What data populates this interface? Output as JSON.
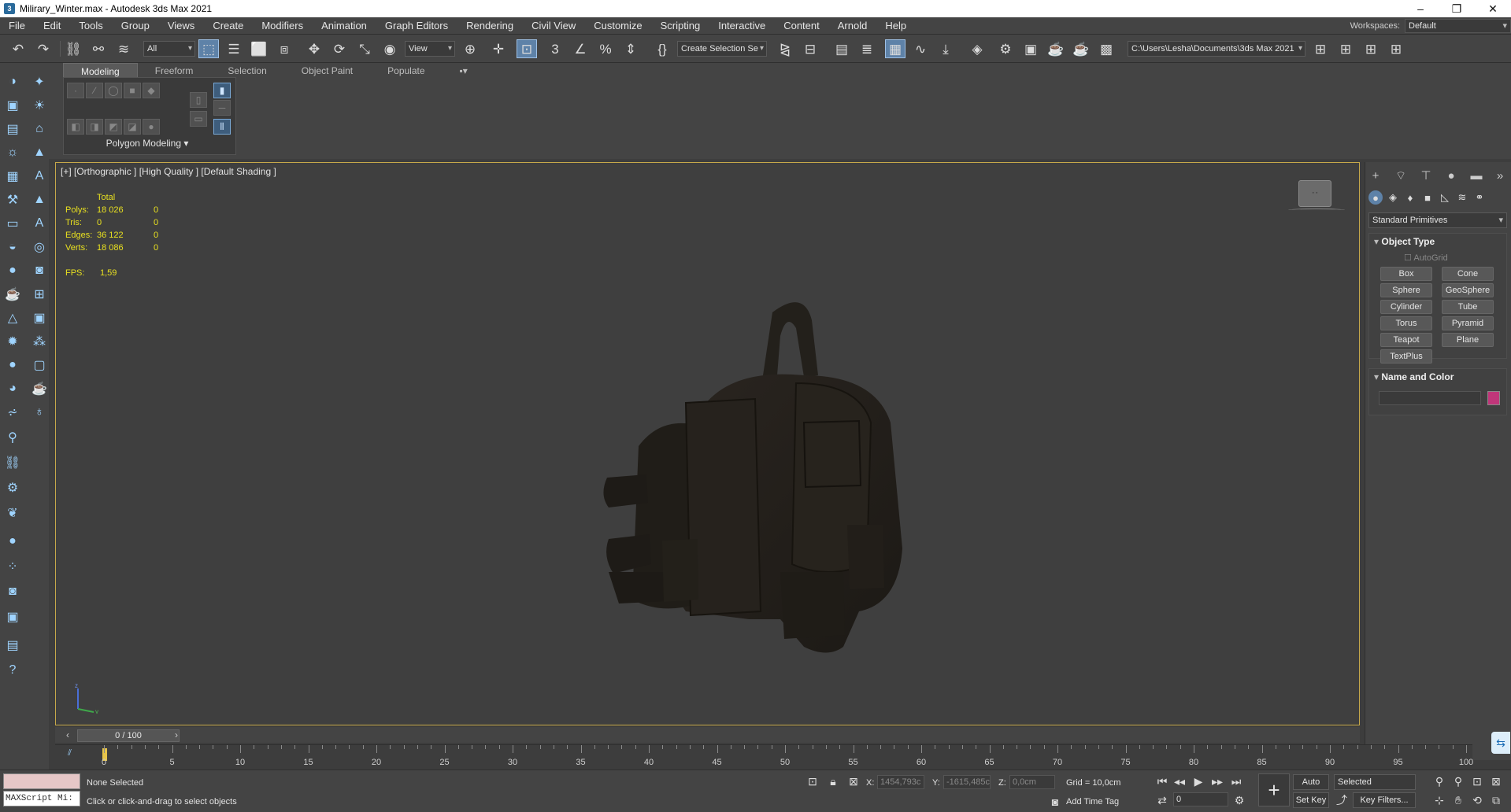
{
  "window": {
    "title": "Milirary_Winter.max - Autodesk 3ds Max 2021"
  },
  "menu": [
    "File",
    "Edit",
    "Tools",
    "Group",
    "Views",
    "Create",
    "Modifiers",
    "Animation",
    "Graph Editors",
    "Rendering",
    "Civil View",
    "Customize",
    "Scripting",
    "Interactive",
    "Content",
    "Arnold",
    "Help"
  ],
  "workspace": {
    "label": "Workspaces:",
    "value": "Default"
  },
  "toolbar": {
    "filter": "All",
    "ref_coord": "View",
    "selection_set": "Create Selection Se",
    "project_path": "C:\\Users\\Lesha\\Documents\\3ds Max 2021"
  },
  "ribbon": {
    "tabs": [
      "Modeling",
      "Freeform",
      "Selection",
      "Object Paint",
      "Populate"
    ],
    "panel_title": "Polygon Modeling"
  },
  "viewport": {
    "label": "[+] [Orthographic ] [High Quality ] [Default Shading ]",
    "stats": {
      "header": "Total",
      "rows": [
        {
          "k": "Polys:",
          "v": "18 026",
          "s": "0"
        },
        {
          "k": "Tris:",
          "v": "0",
          "s": "0"
        },
        {
          "k": "Edges:",
          "v": "36 122",
          "s": "0"
        },
        {
          "k": "Verts:",
          "v": "18 086",
          "s": "0"
        }
      ],
      "fps_label": "FPS:",
      "fps": "1,59"
    },
    "gizmo": {
      "x": "x",
      "y": "y",
      "z": "z"
    }
  },
  "command_panel": {
    "dropdown": "Standard Primitives",
    "object_type": {
      "title": "Object Type",
      "autogrid": "AutoGrid",
      "buttons": [
        "Box",
        "Cone",
        "Sphere",
        "GeoSphere",
        "Cylinder",
        "Tube",
        "Torus",
        "Pyramid",
        "Teapot",
        "Plane",
        "TextPlus"
      ]
    },
    "name_color": {
      "title": "Name and Color",
      "color": "#c0367a"
    }
  },
  "timeline": {
    "frame": "0 / 100",
    "ticks": [
      "0",
      "5",
      "10",
      "15",
      "20",
      "25",
      "30",
      "35",
      "40",
      "45",
      "50",
      "55",
      "60",
      "65",
      "70",
      "75",
      "80",
      "85",
      "90",
      "95",
      "100"
    ]
  },
  "status": {
    "maxscript": "MAXScript Mi:",
    "selection": "None Selected",
    "prompt": "Click or click-and-drag to select objects",
    "x_label": "X:",
    "x": "1454,793c",
    "y_label": "Y:",
    "y": "-1615,485c",
    "z_label": "Z:",
    "z": "0,0cm",
    "grid": "Grid = 10,0cm",
    "add_time_tag": "Add Time Tag",
    "auto_key": "Auto Key",
    "set_key": "Set Key",
    "key_mode": "Selected",
    "key_filters": "Key Filters...",
    "frame_field": "0"
  }
}
